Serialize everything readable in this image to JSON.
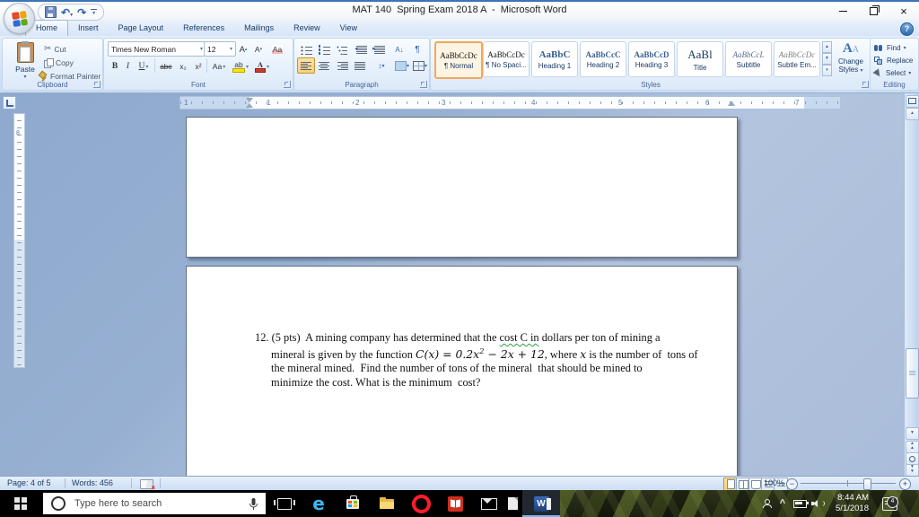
{
  "titlebar": {
    "title": "MAT 140  Spring Exam 2018 A  -  Microsoft Word"
  },
  "ribbon_tabs": [
    "Home",
    "Insert",
    "Page Layout",
    "References",
    "Mailings",
    "Review",
    "View"
  ],
  "clipboard": {
    "label": "Clipboard",
    "paste": "Paste",
    "cut": "Cut",
    "copy": "Copy",
    "format_painter": "Format Painter"
  },
  "font": {
    "label": "Font",
    "family": "Times New Roman",
    "size": "12"
  },
  "paragraph": {
    "label": "Paragraph"
  },
  "styles": {
    "label": "Styles",
    "change_line1": "Change",
    "change_line2": "Styles",
    "items": [
      {
        "sample": "AaBbCcDc",
        "name": "¶ Normal"
      },
      {
        "sample": "AaBbCcDc",
        "name": "¶ No Spaci..."
      },
      {
        "sample": "AaBbC",
        "name": "Heading 1"
      },
      {
        "sample": "AaBbCcC",
        "name": "Heading 2"
      },
      {
        "sample": "AaBbCcD",
        "name": "Heading 3"
      },
      {
        "sample": "AaBl",
        "name": "Title"
      },
      {
        "sample": "AaBbCcL",
        "name": "Subtitle"
      },
      {
        "sample": "AaBbCcDc",
        "name": "Subtle Em..."
      }
    ]
  },
  "editing": {
    "label": "Editing",
    "find": "Find",
    "replace": "Replace",
    "select": "Select"
  },
  "ruler": {
    "marks": [
      "1",
      "1",
      "2",
      "3",
      "4",
      "5",
      "6",
      "7"
    ],
    "v_mark": "8"
  },
  "document": {
    "line1_a": "12. (5 pts)  A mining company has determined that the ",
    "line1_grammar": "cost C in",
    "line1_b": " dollars per ton of mining a",
    "line2_a": "mineral is given by the function ",
    "formula_base": "C(x) = 0.2x",
    "formula_exp": "2",
    "formula_rest": " − 2x + 12",
    "line2_b": ", where ",
    "line2_var": "x",
    "line2_c": " is the number of  tons of",
    "line3": "the mineral mined.  Find the number of tons of the mineral  that should be mined to",
    "line4": "minimize the cost. What is the minimum  cost?"
  },
  "statusbar": {
    "page": "Page: 4 of 5",
    "words": "Words: 456",
    "zoom": "100%"
  },
  "taskbar": {
    "search_placeholder": "Type here to search",
    "time": "8:44 AM",
    "date": "5/1/2018",
    "badge": "4"
  },
  "icons": {
    "dropdown": "▾",
    "caret_small": "▴",
    "undo": "↶",
    "redo": "↷",
    "cut": "✂",
    "help": "?",
    "close": "×",
    "bold": "B",
    "italic": "I",
    "underline": "U",
    "strike": "abe",
    "subscript": "x₂",
    "superscript": "x²",
    "change_case": "Aa",
    "highlight": "ab",
    "font_color": "A",
    "grow_font": "A",
    "shrink_font": "A",
    "clear_format": "Aa",
    "pilcrow": "¶",
    "sort": "A↓",
    "line_spacing": "↕",
    "up": "▲",
    "down": "▼",
    "word": "W",
    "edge": "e",
    "proof_x": "×",
    "tray_caret": "^",
    "zoom_out": "−",
    "zoom_in": "+"
  },
  "colors": {
    "ribbon_blue": "#d2e2f6",
    "selection_orange": "#f8cf7e",
    "grammar_green": "#2f9e44",
    "taskbar_black": "#000000",
    "doc_background": "#97b0d2",
    "accent_navy": "#1f3c68"
  }
}
